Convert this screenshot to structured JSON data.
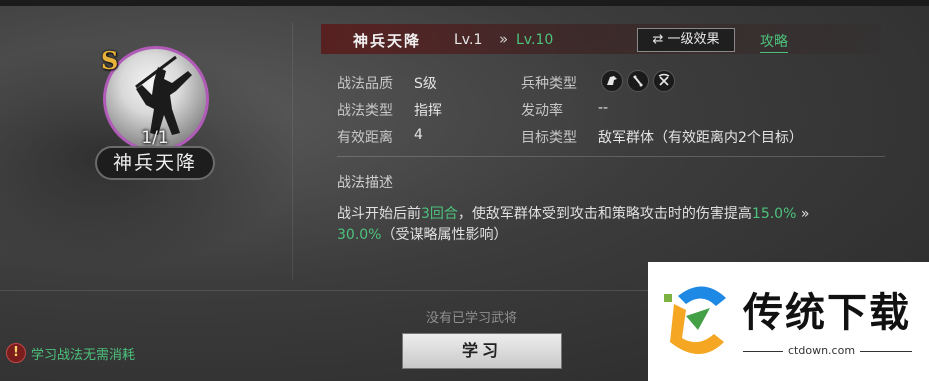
{
  "skill": {
    "grade": "S",
    "uses": "1/1",
    "name": "神兵天降"
  },
  "header": {
    "title": "神兵天降",
    "level": "Lv.1",
    "arrow": "»",
    "max_level": "Lv.10",
    "effect_button": "⇄ 一级效果",
    "guide_link": "攻略"
  },
  "stats": {
    "quality_label": "战法品质",
    "quality_value": "S级",
    "type_label": "战法类型",
    "type_value": "指挥",
    "range_label": "有效距离",
    "range_value": "4",
    "troop_label": "兵种类型",
    "troop_icons": [
      "cavalry-icon",
      "shield-icon",
      "bow-icon"
    ],
    "rate_label": "发动率",
    "rate_value": "--",
    "target_label": "目标类型",
    "target_value": "敌军群体（有效距离内2个目标）"
  },
  "description": {
    "heading": "战法描述",
    "part1": "战斗开始后前",
    "turns": "3回合",
    "part2": "，使敌军群体受到攻击和策略攻击时的伤害提高",
    "value_from": "15.0%",
    "arrow": " »",
    "value_to": "30.0%",
    "part3": "（受谋略属性影响）"
  },
  "footer": {
    "no_general": "没有已学习武将",
    "learn_button": "学习",
    "notice": "学习战法无需消耗"
  },
  "watermark": {
    "title": "传统下载",
    "url": "ctdown.com"
  },
  "colors": {
    "accent_green": "#4cc27c",
    "grade_gold": "#e8b13a",
    "portrait_ring": "#b05bb8"
  }
}
